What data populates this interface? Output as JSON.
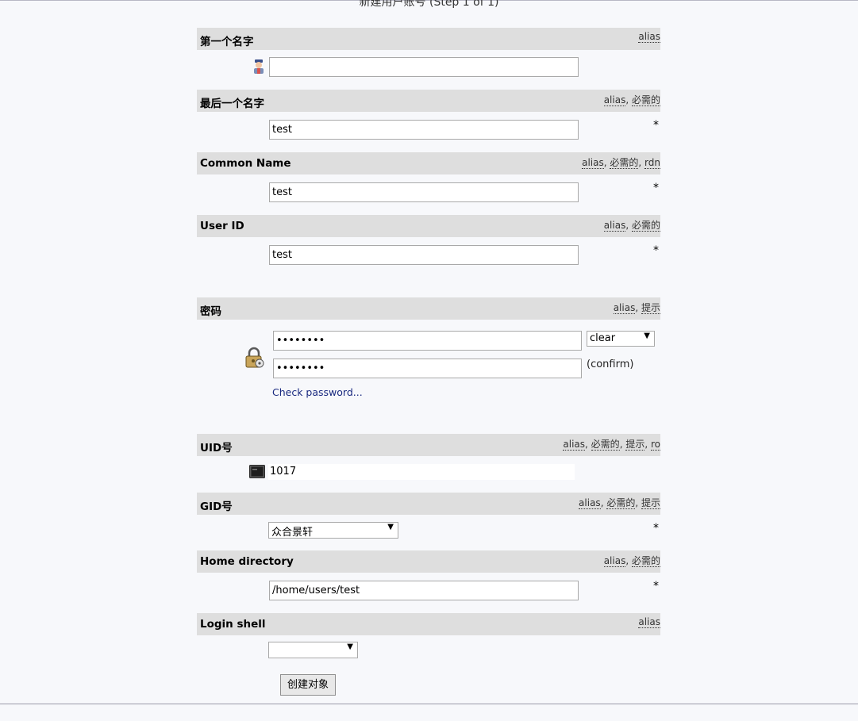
{
  "page": {
    "step_title": "新建用户账号 (Step 1 of 1)"
  },
  "fields": [
    {
      "label": "第一个名字",
      "hints": [
        "alias"
      ],
      "value": ""
    },
    {
      "label": "最后一个名字",
      "hints": [
        "alias",
        "必需的"
      ],
      "value": "test",
      "required": "*"
    },
    {
      "label": "Common Name",
      "hints": [
        "alias",
        "必需的",
        "rdn"
      ],
      "value": "test",
      "required": "*"
    },
    {
      "label": "User ID",
      "hints": [
        "alias",
        "必需的"
      ],
      "value": "test",
      "required": "*"
    },
    {
      "label": "密码",
      "hints": [
        "alias",
        "提示"
      ]
    },
    {
      "label": "UID号",
      "hints": [
        "alias",
        "必需的",
        "提示",
        "ro"
      ]
    },
    {
      "label": "GID号",
      "hints": [
        "alias",
        "必需的",
        "提示"
      ]
    },
    {
      "label": "Home directory",
      "hints": [
        "alias",
        "必需的"
      ],
      "value": "/home/users/test",
      "required": "*"
    },
    {
      "label": "Login shell",
      "hints": [
        "alias"
      ]
    }
  ],
  "password": {
    "value": "••••••••",
    "confirm_value": "••••••••",
    "hash_select": "clear",
    "confirm_label": "(confirm)",
    "check_link": "Check password..."
  },
  "uid": {
    "value": "1017"
  },
  "gid": {
    "selected": "众合景轩",
    "required": "*"
  },
  "login_shell": {
    "selected": ""
  },
  "submit": {
    "label": "创建对象"
  },
  "icons": {
    "person": "person-icon",
    "lock": "lock-icon",
    "terminal": "terminal-icon",
    "dropdown": "chevron-down-icon"
  }
}
